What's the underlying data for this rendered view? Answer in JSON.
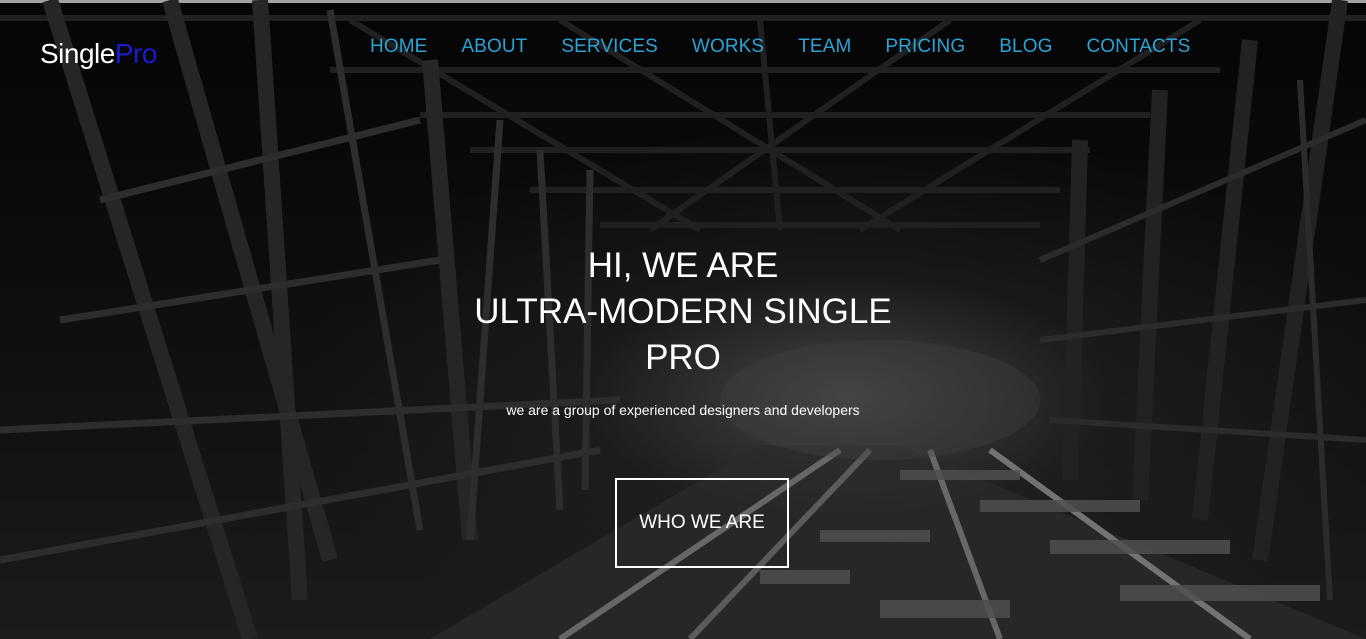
{
  "brand": {
    "name_plain": "Single",
    "name_accent": "Pro"
  },
  "nav": {
    "items": [
      {
        "label": "HOME"
      },
      {
        "label": "ABOUT"
      },
      {
        "label": "SERVICES"
      },
      {
        "label": "WORKS"
      },
      {
        "label": "TEAM"
      },
      {
        "label": "PRICING"
      },
      {
        "label": "BLOG"
      },
      {
        "label": "CONTACTS"
      }
    ]
  },
  "hero": {
    "headline_line1": "HI, WE ARE",
    "headline_line2": "ULTRA-MODERN SINGLE",
    "headline_line3": "PRO",
    "subtitle": "we are a group of experienced designers and developers",
    "cta_label": "WHO WE ARE"
  },
  "colors": {
    "nav_link": "#2aa3d6",
    "brand_accent": "#1a1ad6",
    "text": "#ffffff"
  }
}
